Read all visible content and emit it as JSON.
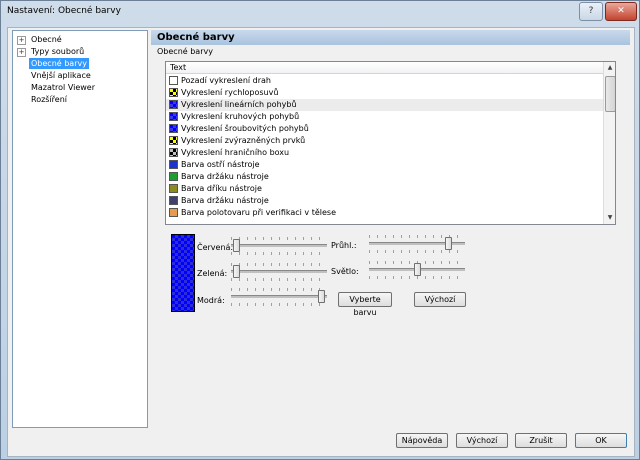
{
  "window": {
    "title": "Nastavení: Obecné barvy"
  },
  "tree": [
    {
      "label": "Obecné",
      "expandable": true,
      "selected": false
    },
    {
      "label": "Typy souborů",
      "expandable": true,
      "selected": false
    },
    {
      "label": "Obecné barvy",
      "expandable": false,
      "selected": true
    },
    {
      "label": "Vnější aplikace",
      "expandable": false,
      "selected": false
    },
    {
      "label": "Mazatrol Viewer",
      "expandable": false,
      "selected": false
    },
    {
      "label": "Rozšíření",
      "expandable": false,
      "selected": false
    }
  ],
  "panel": {
    "header": "Obecné barvy",
    "group_label": "Obecné barvy",
    "list_header": "Text"
  },
  "colors": [
    {
      "label": "Pozadí vykreslení drah",
      "color": "#ffffff",
      "pattern": "solid"
    },
    {
      "label": "Vykreslení rychloposuvů",
      "color": "#ffff00",
      "pattern": "checker"
    },
    {
      "label": "Vykreslení lineárních pohybů",
      "color": "#0000ff",
      "pattern": "checker",
      "highlighted": true
    },
    {
      "label": "Vykreslení kruhových pohybů",
      "color": "#0000ff",
      "pattern": "checker"
    },
    {
      "label": "Vykreslení šroubovitých pohybů",
      "color": "#0000ff",
      "pattern": "checker"
    },
    {
      "label": "Vykreslení zvýrazněných prvků",
      "color": "#ffff00",
      "pattern": "checker"
    },
    {
      "label": "Vykreslení hraničního boxu",
      "color": "#c0c0c0",
      "pattern": "checker"
    },
    {
      "label": "Barva ostří nástroje",
      "color": "#1f2fd0",
      "pattern": "solid"
    },
    {
      "label": "Barva držáku nástroje",
      "color": "#1e9e2e",
      "pattern": "solid"
    },
    {
      "label": "Barva dříku nástroje",
      "color": "#8c8c1e",
      "pattern": "solid"
    },
    {
      "label": "Barva držáku nástroje",
      "color": "#404070",
      "pattern": "solid"
    },
    {
      "label": "Barva polotovaru při verifikaci v tělese",
      "color": "#e89a50",
      "pattern": "solid"
    }
  ],
  "sliders": {
    "red": {
      "label": "Červená:",
      "value": 0.02
    },
    "green": {
      "label": "Zelená:",
      "value": 0.02
    },
    "blue": {
      "label": "Modrá:",
      "value": 0.98
    },
    "alpha": {
      "label": "Průhl.:",
      "value": 0.85
    },
    "light": {
      "label": "Světlo:",
      "value": 0.5
    }
  },
  "buttons": {
    "choose_color": "Vyberte barvu",
    "default_color": "Výchozí",
    "help": "Nápověda",
    "default": "Výchozí",
    "cancel": "Zrušit",
    "ok": "OK"
  }
}
